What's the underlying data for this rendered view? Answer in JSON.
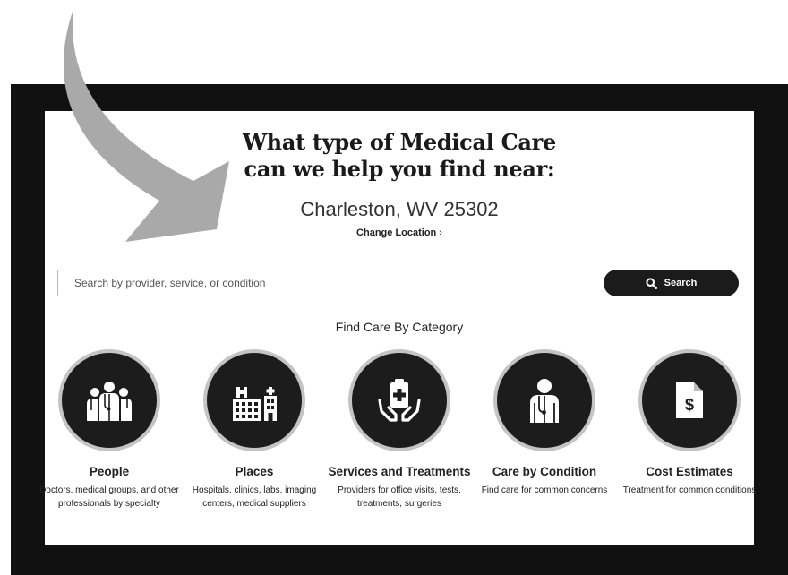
{
  "headline": {
    "line1": "What type of Medical Care",
    "line2": "can we help you find near:"
  },
  "location": "Charleston, WV 25302",
  "change_location": {
    "label": "Change Location",
    "chevron": "›"
  },
  "search": {
    "placeholder": "Search by provider, service, or condition",
    "value": "",
    "button_label": "Search",
    "button_icon": "search-icon"
  },
  "categories_title": "Find Care By Category",
  "categories": [
    {
      "icon": "people-group-icon",
      "title": "People",
      "description": "Doctors, medical groups, and other professionals by specialty"
    },
    {
      "icon": "hospital-building-icon",
      "title": "Places",
      "description": "Hospitals, clinics, labs, imaging centers, medical suppliers"
    },
    {
      "icon": "hands-clipboard-icon",
      "title": "Services and Treatments",
      "description": "Providers for office visits, tests, treatments, surgeries"
    },
    {
      "icon": "doctor-icon",
      "title": "Care by Condition",
      "description": "Find care for common concerns"
    },
    {
      "icon": "dollar-document-icon",
      "title": "Cost Estimates",
      "description": "Treatment for common conditions"
    }
  ],
  "colors": {
    "frame": "#111111",
    "arrow": "#a9a9a9",
    "button": "#1b1b1b",
    "circle_ring": "#c4c4c4",
    "circle_fill": "#1c1c1c"
  }
}
